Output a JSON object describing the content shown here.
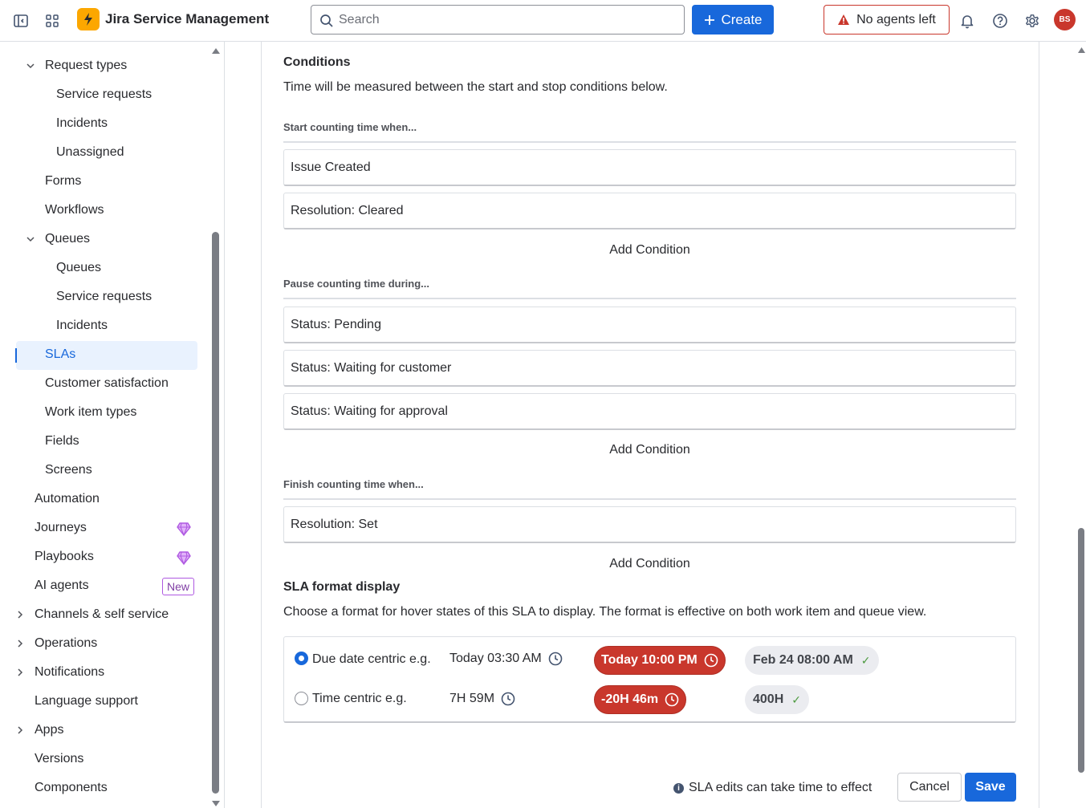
{
  "topbar": {
    "app_title": "Jira Service Management",
    "search_placeholder": "Search",
    "create_label": "Create",
    "agents_warning": "No agents left",
    "avatar_initials": "BS"
  },
  "sidebar": {
    "items": [
      {
        "label": "Request types",
        "level": 1,
        "chevron": "down"
      },
      {
        "label": "Service requests",
        "level": 2
      },
      {
        "label": "Incidents",
        "level": 2
      },
      {
        "label": "Unassigned",
        "level": 2
      },
      {
        "label": "Forms",
        "level": 1
      },
      {
        "label": "Workflows",
        "level": 1
      },
      {
        "label": "Queues",
        "level": 1,
        "chevron": "down"
      },
      {
        "label": "Queues",
        "level": 2
      },
      {
        "label": "Service requests",
        "level": 2
      },
      {
        "label": "Incidents",
        "level": 2
      },
      {
        "label": "SLAs",
        "level": 1,
        "selected": true
      },
      {
        "label": "Customer satisfaction",
        "level": 1
      },
      {
        "label": "Work item types",
        "level": 1
      },
      {
        "label": "Fields",
        "level": 1
      },
      {
        "label": "Screens",
        "level": 1
      },
      {
        "label": "Automation",
        "level": 0
      },
      {
        "label": "Journeys",
        "level": 0,
        "badge": "gem-icon"
      },
      {
        "label": "Playbooks",
        "level": 0,
        "badge": "gem-icon"
      },
      {
        "label": "AI agents",
        "level": 0,
        "badge_text": "New"
      },
      {
        "label": "Channels & self service",
        "level": 0,
        "chevron": "right"
      },
      {
        "label": "Operations",
        "level": 0,
        "chevron": "right"
      },
      {
        "label": "Notifications",
        "level": 0,
        "chevron": "right"
      },
      {
        "label": "Language support",
        "level": 0
      },
      {
        "label": "Apps",
        "level": 0,
        "chevron": "right"
      },
      {
        "label": "Versions",
        "level": 0
      },
      {
        "label": "Components",
        "level": 0
      }
    ]
  },
  "conditions": {
    "heading": "Conditions",
    "description": "Time will be measured between the start and stop conditions below.",
    "start_label": "Start counting time when...",
    "start_items": [
      "Issue Created",
      "Resolution: Cleared"
    ],
    "pause_label": "Pause counting time during...",
    "pause_items": [
      "Status: Pending",
      "Status: Waiting for customer",
      "Status: Waiting for approval"
    ],
    "finish_label": "Finish counting time when...",
    "finish_items": [
      "Resolution: Set"
    ],
    "add_condition": "Add Condition"
  },
  "sla_format": {
    "heading": "SLA format display",
    "description": "Choose a format for hover states of this SLA to display. The format is effective on both work item and queue view.",
    "options": [
      {
        "label": "Due date centric e.g.",
        "selected": true,
        "example": "Today 03:30 AM",
        "breached": "Today 10:00 PM",
        "met": "Feb 24 08:00 AM"
      },
      {
        "label": "Time centric e.g.",
        "selected": false,
        "example": "7H 59M",
        "breached": "-20H 46m",
        "met": "400H"
      }
    ]
  },
  "footer": {
    "note": "SLA edits can take time to effect",
    "cancel": "Cancel",
    "save": "Save"
  },
  "colors": {
    "accent": "#1868DB",
    "danger": "#C9372C",
    "selected_bg": "#E9F2FE",
    "logo": "#FCA700"
  }
}
